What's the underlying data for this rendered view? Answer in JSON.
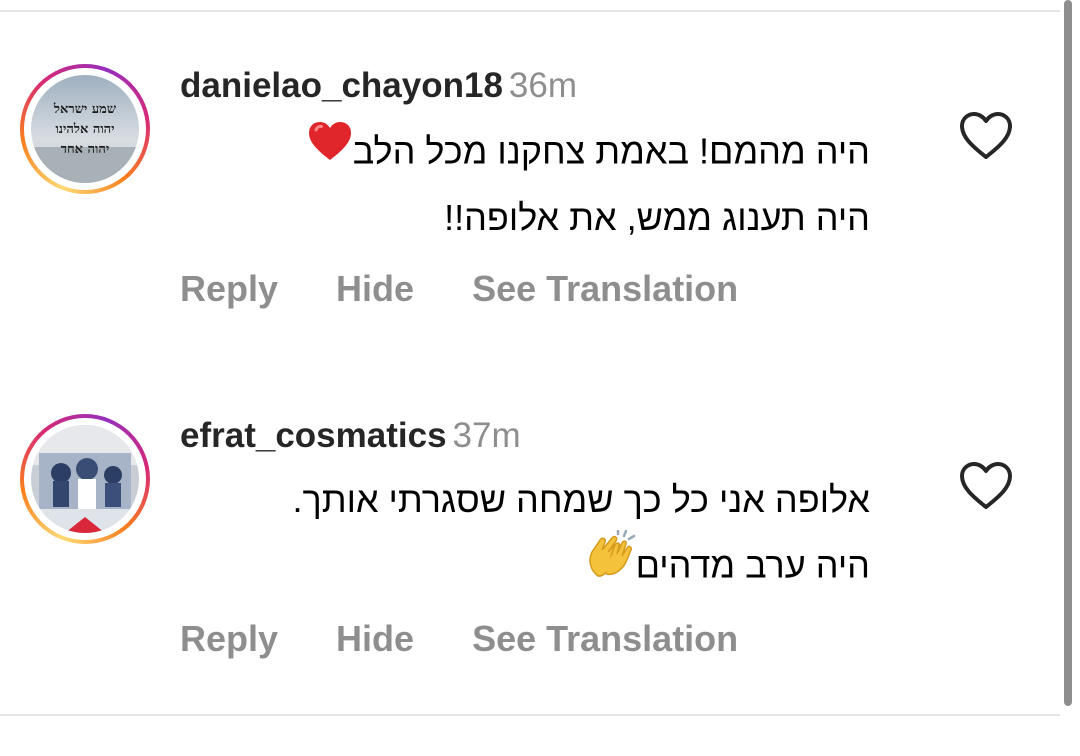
{
  "comments": [
    {
      "username": "danielao_chayon18",
      "time": "36m",
      "lines": [
        "היה מהמם! באמת צחקנו מכל הלב",
        "היה תענוג ממש, את אלופה!!"
      ],
      "emoji_icon": "red-heart-emoji",
      "avatar_text": [
        "שמע ישראל",
        "יהוה אלהינו",
        "יהוה אחד"
      ],
      "actions": {
        "reply": "Reply",
        "hide": "Hide",
        "translate": "See Translation"
      }
    },
    {
      "username": "efrat_cosmatics",
      "time": "37m",
      "lines": [
        "אלופה אני כל כך שמחה שסגרתי אותך.",
        "היה ערב מדהים"
      ],
      "emoji_icon": "clapping-hands-emoji",
      "actions": {
        "reply": "Reply",
        "hide": "Hide",
        "translate": "See Translation"
      }
    }
  ],
  "icons": {
    "like": "heart-outline-icon"
  },
  "colors": {
    "username": "#262626",
    "secondary": "#8e8e8e",
    "story_ring": [
      "#feda75",
      "#fa7e1e",
      "#d62976",
      "#962fbf"
    ]
  }
}
